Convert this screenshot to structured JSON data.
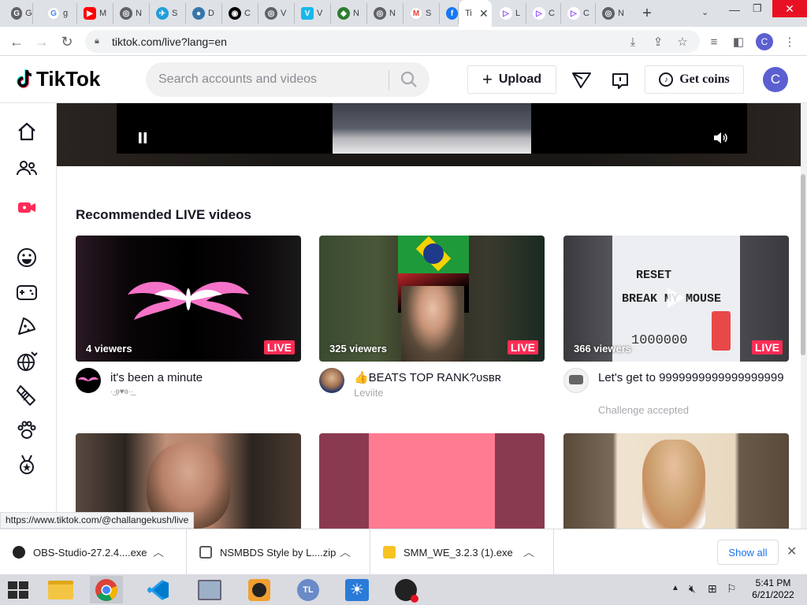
{
  "browser": {
    "tabs": [
      {
        "letter": "G",
        "color": "#5f6368",
        "text": "G"
      },
      {
        "letter": "G",
        "color": "#4285f4",
        "text": "g"
      },
      {
        "letter": "▶",
        "color": "#ff0000",
        "text": "M"
      },
      {
        "letter": "◎",
        "color": "#5f6368",
        "text": "N"
      },
      {
        "letter": "✈",
        "color": "#229ed9",
        "text": "S"
      },
      {
        "letter": "●",
        "color": "#3776ab",
        "text": "D"
      },
      {
        "letter": "◉",
        "color": "#000000",
        "text": "C"
      },
      {
        "letter": "◎",
        "color": "#5f6368",
        "text": "V"
      },
      {
        "letter": "V",
        "color": "#1ab7ea",
        "text": "V"
      },
      {
        "letter": "◆",
        "color": "#2e7d32",
        "text": "N"
      },
      {
        "letter": "◎",
        "color": "#5f6368",
        "text": "N"
      },
      {
        "letter": "M",
        "color": "#ea4335",
        "text": "S"
      },
      {
        "letter": "f",
        "color": "#1877f2",
        "text": "F"
      },
      {
        "letter": "♪",
        "color": "#000000",
        "text": "Ti"
      },
      {
        "letter": "▷",
        "color": "#9146ff",
        "text": "L"
      },
      {
        "letter": "▷",
        "color": "#9146ff",
        "text": "C"
      },
      {
        "letter": "▷",
        "color": "#9146ff",
        "text": "C"
      },
      {
        "letter": "◎",
        "color": "#5f6368",
        "text": "N"
      }
    ],
    "url": "tiktok.com/live?lang=en",
    "profile_initial": "C"
  },
  "header": {
    "logo_text": "TikTok",
    "search_placeholder": "Search accounts and videos",
    "upload_label": "Upload",
    "coins_label": "Get coins",
    "avatar_initial": "C"
  },
  "section_title": "Recommended LIVE videos",
  "live_badge": "LIVE",
  "cards": [
    {
      "viewers": "4 viewers",
      "title": "it's been a minute",
      "subtitle": "·͜·ʚ♥ɞ·͜·"
    },
    {
      "viewers": "325 viewers",
      "title": "👍BEATS TOP RANK?ᴜsʙʀ",
      "subtitle": "Leviite"
    },
    {
      "viewers": "366 viewers",
      "title": "Let's get to 9999999999999999999",
      "subtitle": "Challenge accepted"
    }
  ],
  "hover_url": "https://www.tiktok.com/@challangekush/live",
  "downloads": [
    {
      "name": "OBS-Studio-27.2.4....exe"
    },
    {
      "name": "NSMBDS Style by L....zip"
    },
    {
      "name": "SMM_WE_3.2.3 (1).exe"
    }
  ],
  "show_all_label": "Show all",
  "clock": {
    "time": "5:41 PM",
    "date": "6/21/2022"
  }
}
